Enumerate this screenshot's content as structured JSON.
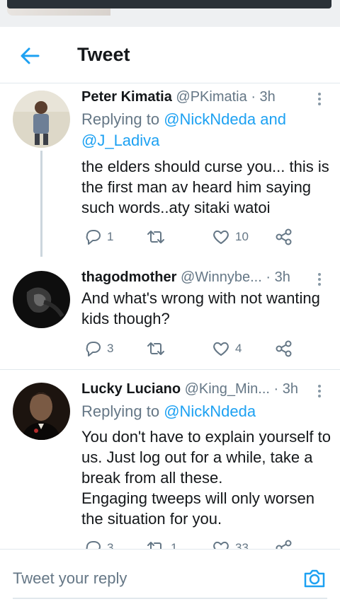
{
  "header": {
    "title": "Tweet"
  },
  "tweets": [
    {
      "name": "Peter Kimatia",
      "handle": "@PKimatia",
      "time": "· 3h",
      "replying_prefix": "Replying to ",
      "replying_mention1": "@NickNdeda",
      "replying_and": " and",
      "replying_mention2": "@J_Ladiva",
      "text": [
        "the elders should curse you... this is",
        "the first man av heard him saying",
        "such words..aty sitaki watoi"
      ],
      "replies": "1",
      "retweets": "",
      "likes": "10"
    },
    {
      "name": "thagodmother",
      "handle": "@Winnybe...",
      "time": "· 3h",
      "text": [
        "And what's wrong with not wanting",
        "kids though?"
      ],
      "replies": "3",
      "retweets": "",
      "likes": "4"
    },
    {
      "name": "Lucky Luciano",
      "handle": "@King_Min...",
      "time": "· 3h",
      "replying_prefix": "Replying to ",
      "replying_mention1": "@NickNdeda",
      "text": [
        "You don't have to explain yourself to",
        "us. Just log out for a while, take a",
        "break from all these.",
        "Engaging tweeps will only worsen",
        "the situation for you."
      ],
      "replies": "3",
      "retweets": "1",
      "likes": "33"
    }
  ],
  "reply_bar": {
    "placeholder": "Tweet your reply"
  },
  "colors": {
    "accent": "#1da1f2",
    "secondary_text": "#657786",
    "primary_text": "#14171a",
    "divider": "#e1e8ed"
  },
  "icons": {
    "back": "arrow-left-icon",
    "more": "more-vertical-icon",
    "reply": "reply-icon",
    "retweet": "retweet-icon",
    "like": "heart-icon",
    "share": "share-icon",
    "camera": "camera-icon"
  }
}
